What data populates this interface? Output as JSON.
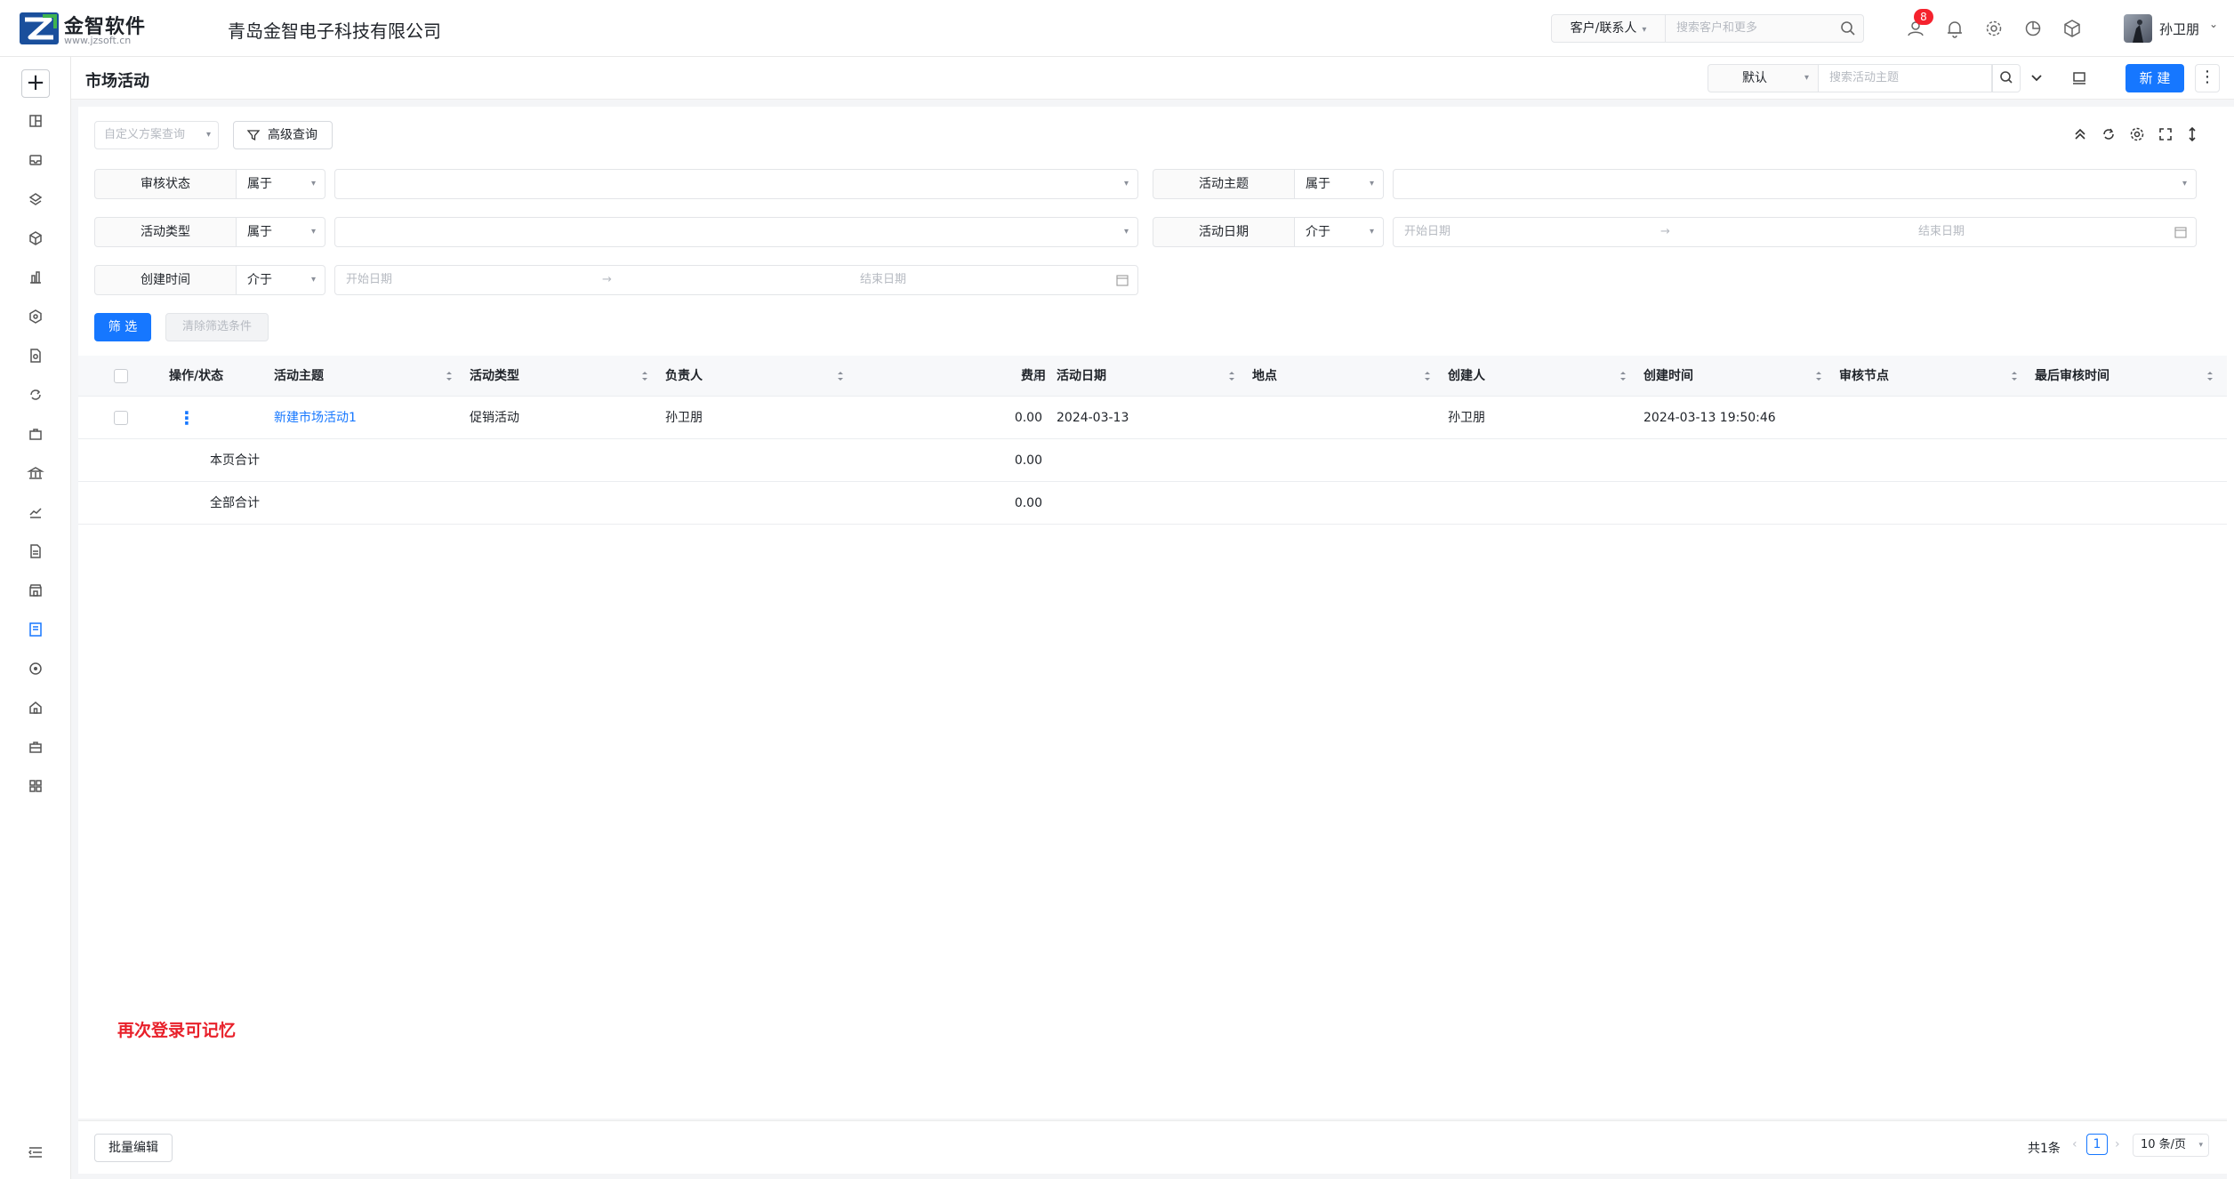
{
  "app": {
    "logo_text": "金智软件",
    "logo_sub": "www.jzsoft.cn",
    "company": "青岛金智电子科技有限公司"
  },
  "topbar": {
    "search_scope": "客户/联系人",
    "search_placeholder": "搜索客户和更多",
    "message_badge": "8",
    "user_name": "孙卫朋"
  },
  "page": {
    "title": "市场活动",
    "view_select": "默认",
    "search_placeholder": "搜索活动主题",
    "new_button": "新 建"
  },
  "query": {
    "scheme_placeholder": "自定义方案查询",
    "advanced_button": "高级查询",
    "filter_button": "筛 选",
    "clear_button": "清除筛选条件"
  },
  "filters": [
    {
      "label": "审核状态",
      "op": "属于"
    },
    {
      "label": "活动主题",
      "op": "属于"
    },
    {
      "label": "活动类型",
      "op": "属于"
    },
    {
      "label": "活动日期",
      "op": "介于",
      "start": "开始日期",
      "end": "结束日期"
    },
    {
      "label": "创建时间",
      "op": "介于",
      "start": "开始日期",
      "end": "结束日期"
    }
  ],
  "table": {
    "columns": [
      "操作/状态",
      "活动主题",
      "活动类型",
      "负责人",
      "费用",
      "活动日期",
      "地点",
      "创建人",
      "创建时间",
      "审核节点",
      "最后审核时间"
    ],
    "rows": [
      {
        "subject": "新建市场活动1",
        "type": "促销活动",
        "owner": "孙卫朋",
        "cost": "0.00",
        "date": "2024-03-13",
        "location": "",
        "creator": "孙卫朋",
        "created": "2024-03-13 19:50:46",
        "node": "",
        "last_audit": ""
      }
    ],
    "page_total_label": "本页合计",
    "page_total_cost": "0.00",
    "all_total_label": "全部合计",
    "all_total_cost": "0.00"
  },
  "note": "再次登录可记忆",
  "footer": {
    "batch_edit": "批量编辑",
    "total": "共1条",
    "current_page": "1",
    "page_size": "10 条/页"
  },
  "colors": {
    "primary": "#1677ff",
    "badge": "#f5222d",
    "note": "#e8202a"
  }
}
